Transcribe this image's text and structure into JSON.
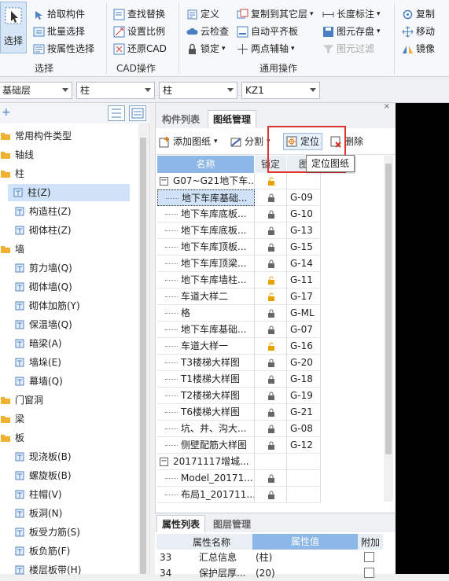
{
  "ribbon": {
    "select_label": "选择",
    "select_group_label": "选择",
    "select_items": [
      "拾取构件",
      "批量选择",
      "按属性选择"
    ],
    "cad_items": [
      "查找替换",
      "设置比例",
      "还原CAD"
    ],
    "cad_group_label": "CAD操作",
    "common_col1": [
      "定义",
      "云检查",
      "锁定"
    ],
    "common_col2": [
      "复制到其它层",
      "自动平齐板",
      "两点辅轴"
    ],
    "common_col3": [
      "长度标注",
      "图元存盘",
      "图元过滤"
    ],
    "common_group_label": "通用操作",
    "edit_items": [
      "复制",
      "移动",
      "镜像"
    ]
  },
  "selectors": {
    "floor": "基础层",
    "category": "柱",
    "type": "柱",
    "component": "KZ1"
  },
  "left_tree": {
    "items": [
      {
        "label": "常用构件类型",
        "level": 0
      },
      {
        "label": "轴线",
        "level": 0
      },
      {
        "label": "柱",
        "level": 0
      },
      {
        "label": "柱(Z)",
        "level": 1,
        "selected": true
      },
      {
        "label": "构造柱(Z)",
        "level": 1
      },
      {
        "label": "砌体柱(Z)",
        "level": 1
      },
      {
        "label": "墙",
        "level": 0
      },
      {
        "label": "剪力墙(Q)",
        "level": 1
      },
      {
        "label": "砌体墙(Q)",
        "level": 1
      },
      {
        "label": "砌体加筋(Y)",
        "level": 1
      },
      {
        "label": "保温墙(Q)",
        "level": 1
      },
      {
        "label": "暗梁(A)",
        "level": 1
      },
      {
        "label": "墙垛(E)",
        "level": 1
      },
      {
        "label": "幕墙(Q)",
        "level": 1
      },
      {
        "label": "门窗洞",
        "level": 0
      },
      {
        "label": "梁",
        "level": 0
      },
      {
        "label": "板",
        "level": 0
      },
      {
        "label": "现浇板(B)",
        "level": 1
      },
      {
        "label": "螺旋板(B)",
        "level": 1
      },
      {
        "label": "柱帽(V)",
        "level": 1
      },
      {
        "label": "板洞(N)",
        "level": 1
      },
      {
        "label": "板受力筋(S)",
        "level": 1
      },
      {
        "label": "板负筋(F)",
        "level": 1
      },
      {
        "label": "楼层板带(H)",
        "level": 1
      }
    ]
  },
  "mid_panel": {
    "tabs": [
      "构件列表",
      "图纸管理"
    ],
    "tools": {
      "add": "添加图纸",
      "split": "分割",
      "locate": "定位",
      "delete": "删除"
    },
    "tooltip": "定位图纸",
    "columns": {
      "name": "名称",
      "lock": "锁定",
      "drawing": "图"
    },
    "rows": [
      {
        "name": "G07~G21地下车...",
        "code": "",
        "group": true,
        "lock": "open"
      },
      {
        "name": "地下车库基础...",
        "code": "G-09",
        "lock": "closed",
        "selected": true
      },
      {
        "name": "地下车库底板...",
        "code": "G-10",
        "lock": "closed"
      },
      {
        "name": "地下车库底板...",
        "code": "G-13",
        "lock": "closed"
      },
      {
        "name": "地下车库顶板...",
        "code": "G-15",
        "lock": "closed"
      },
      {
        "name": "地下车库顶梁...",
        "code": "G-14",
        "lock": "closed"
      },
      {
        "name": "地下车库墙柱...",
        "code": "G-11",
        "lock": "open"
      },
      {
        "name": "车道大样二",
        "code": "G-17",
        "lock": "open"
      },
      {
        "name": "格",
        "code": "G-ML",
        "lock": "closed"
      },
      {
        "name": "地下车库基础...",
        "code": "G-07",
        "lock": "closed"
      },
      {
        "name": "车道大样一",
        "code": "G-16",
        "lock": "open"
      },
      {
        "name": "T3楼梯大样图",
        "code": "G-20",
        "lock": "closed"
      },
      {
        "name": "T1楼梯大样图",
        "code": "G-18",
        "lock": "closed"
      },
      {
        "name": "T2楼梯大样图",
        "code": "G-19",
        "lock": "closed"
      },
      {
        "name": "T6楼梯大样图",
        "code": "G-21",
        "lock": "closed"
      },
      {
        "name": "坑、井、沟大...",
        "code": "G-08",
        "lock": "closed"
      },
      {
        "name": "侧壁配筋大样图",
        "code": "G-12",
        "lock": "closed"
      },
      {
        "name": "20171117增城...",
        "code": "",
        "group": true,
        "lock": "none"
      },
      {
        "name": "Model_20171...",
        "code": "",
        "lock": "closed"
      },
      {
        "name": "布局1_201711...",
        "code": "",
        "lock": "closed"
      }
    ]
  },
  "props": {
    "tabs": [
      "属性列表",
      "图层管理"
    ],
    "columns": {
      "name": "属性名称",
      "value": "属性值",
      "extra": "附加"
    },
    "rows": [
      {
        "num": "33",
        "name": "汇总信息",
        "value": "(柱)"
      },
      {
        "num": "34",
        "name": "保护层厚...",
        "value": "(20)"
      }
    ]
  },
  "colors": {
    "accent": "#8db7e6",
    "highlight": "#e0332f",
    "lock_open": "#e8a200"
  }
}
